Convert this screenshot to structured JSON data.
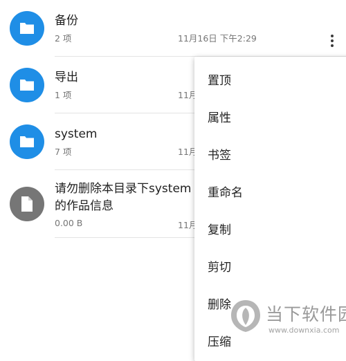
{
  "files": [
    {
      "name": "备份",
      "meta": "2 项",
      "date": "11月16日 下午2:29",
      "type": "folder"
    },
    {
      "name": "导出",
      "meta": "1 项",
      "date": "11月",
      "type": "folder"
    },
    {
      "name": "system",
      "meta": "7 项",
      "date": "11月",
      "type": "folder"
    },
    {
      "name_line1": "请勿删除本目录下system",
      "name_line2": "的作品信息",
      "meta": "0.00 B",
      "date": "11月",
      "type": "file"
    }
  ],
  "context_menu": {
    "items": [
      "置顶",
      "属性",
      "书签",
      "重命名",
      "复制",
      "剪切",
      "删除",
      "压缩"
    ]
  },
  "watermark": {
    "text": "当下软件园",
    "url": "www.downxia.com"
  },
  "colors": {
    "folder_icon_bg": "#1f8ee6",
    "file_icon_bg": "#767676"
  },
  "icons": {
    "folder": "folder-icon",
    "file": "file-icon",
    "more": "more-vert-icon"
  }
}
